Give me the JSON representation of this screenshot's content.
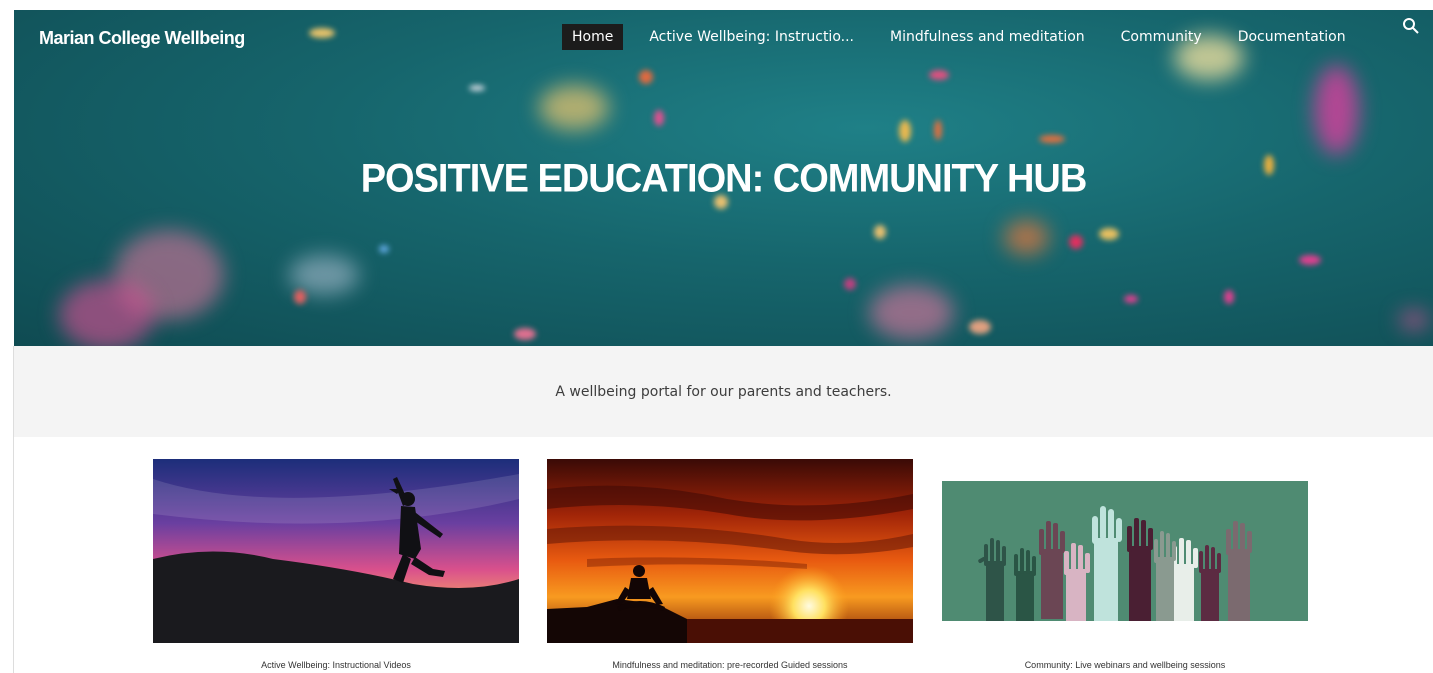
{
  "site": {
    "brand": "Marian College Wellbeing"
  },
  "nav": {
    "items": [
      {
        "label": "Home",
        "active": true
      },
      {
        "label": "Active Wellbeing: Instructio..."
      },
      {
        "label": "Mindfulness and meditation"
      },
      {
        "label": "Community"
      },
      {
        "label": "Documentation"
      }
    ],
    "search_icon": "search-icon"
  },
  "hero": {
    "title": "POSITIVE EDUCATION: COMMUNITY HUB",
    "background_color": "#16656c"
  },
  "tagline": "A wellbeing portal for our parents and teachers.",
  "cards": [
    {
      "caption": "Active Wellbeing: Instructional Videos",
      "image": "silhouette-jumping-sunset"
    },
    {
      "caption": "Mindfulness and meditation: pre-recorded Guided sessions",
      "image": "silhouette-meditating-sunset"
    },
    {
      "caption": "Community: Live webinars and wellbeing sessions",
      "image": "raised-hands-illustration"
    }
  ]
}
